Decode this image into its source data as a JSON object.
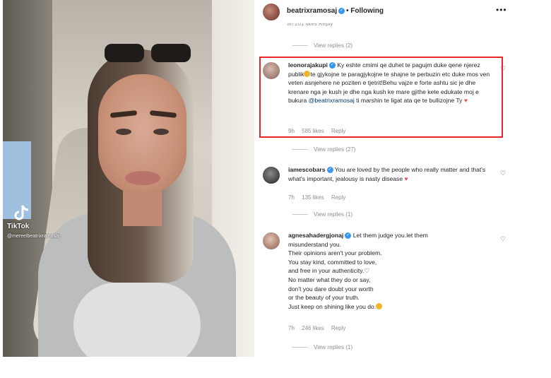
{
  "video": {
    "watermark_logo": "TikTok",
    "watermark_handle": "@mereelbeatrixramosaj"
  },
  "header": {
    "username": "beatrixramosaj",
    "following": "• Following",
    "more_icon": "more-icon"
  },
  "top_clipped_meta": "9h  201 likes  Reply",
  "view_replies_top": "View replies (2)",
  "comments": [
    {
      "username": "leonorajakupi",
      "text_before_emoji": "Ky eshte cmimi qe duhet te pagujm duke qene njerez publik",
      "text_after_emoji": "te gjykojne te paragjykojne te shajne te perbuzin etc duke mos ven veten asnjehere ne poziten e tjetrit!Behu vajze e forte ashtu sic je dhe krenare nga je kush je dhe nga kush ke mare gjithe kete edukate moj e bukura",
      "mention": "@beatrixramosaj",
      "text_after_mention": "ti marshin te ligat ata qe te bullizojne Ty",
      "time": "9h",
      "likes": "585 likes",
      "reply": "Reply",
      "view_replies": "View replies (27)",
      "avatar_color": "#b59a8a"
    },
    {
      "username": "iamescobars",
      "text": "You are loved by the people who really matter and that's what's important, jealousy is nasty disease",
      "time": "7h",
      "likes": "135 likes",
      "reply": "Reply",
      "view_replies": "View replies (1)",
      "avatar_color": "#3b3b3b"
    },
    {
      "username": "agnesahadergjonaj",
      "lines": [
        "Let them judge you.let them",
        "misunderstand you.",
        "Their opinions aren't your problem.",
        "You stay kind, committed to love,",
        "and free in your authenticity.",
        "No matter what they do or say,",
        "don't you dare doubt your worth",
        "or the beauty of your truth.",
        "Just keep on shining like you do."
      ],
      "time": "7h",
      "likes": "246 likes",
      "reply": "Reply",
      "view_replies": "View replies (1)",
      "avatar_color": "#a07a6a"
    }
  ],
  "colors": {
    "highlight_border": "#e8262a",
    "verified": "#3897f0",
    "mention": "#00376b",
    "meta": "#8e8e8e",
    "heart_red": "#ed4956"
  }
}
